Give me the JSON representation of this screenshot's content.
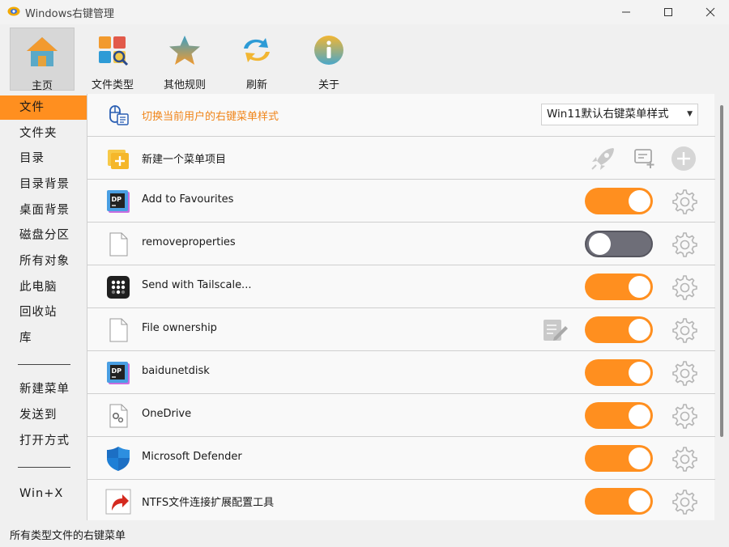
{
  "window": {
    "title": "Windows右键管理"
  },
  "toolbar": {
    "items": [
      {
        "label": "主页",
        "icon": "home-icon",
        "active": true
      },
      {
        "label": "文件类型",
        "icon": "file-types-icon"
      },
      {
        "label": "其他规则",
        "icon": "star-icon"
      },
      {
        "label": "刷新",
        "icon": "refresh-icon"
      },
      {
        "label": "关于",
        "icon": "info-icon"
      }
    ]
  },
  "sidebar": {
    "items": [
      {
        "label": "文件",
        "selected": true
      },
      {
        "label": "文件夹"
      },
      {
        "label": "目录"
      },
      {
        "label": "目录背景"
      },
      {
        "label": "桌面背景"
      },
      {
        "label": "磁盘分区"
      },
      {
        "label": "所有对象"
      },
      {
        "label": "此电脑"
      },
      {
        "label": "回收站"
      },
      {
        "label": "库"
      },
      {
        "label": "新建菜单"
      },
      {
        "label": "发送到"
      },
      {
        "label": "打开方式"
      },
      {
        "label": "Win+X"
      }
    ]
  },
  "content": {
    "switch_style": {
      "label": "切换当前用户的右键菜单样式",
      "dropdown_value": "Win11默认右键菜单样式",
      "icon": "mouse-menu-icon"
    },
    "new_item": {
      "label": "新建一个菜单项目",
      "icon": "new-folder-item-icon"
    },
    "rows": [
      {
        "label": "Add to Favourites",
        "icon": "dp-app-icon",
        "enabled": true
      },
      {
        "label": "removeproperties",
        "icon": "blank-file-icon",
        "enabled": false
      },
      {
        "label": "Send with Tailscale...",
        "icon": "tailscale-icon",
        "enabled": true
      },
      {
        "label": "File ownership",
        "icon": "blank-file-icon",
        "enabled": true,
        "editable": true
      },
      {
        "label": "baidunetdisk",
        "icon": "dp-app-icon",
        "enabled": true
      },
      {
        "label": "OneDrive",
        "icon": "settings-file-icon",
        "enabled": true
      },
      {
        "label": "Microsoft Defender",
        "icon": "defender-shield-icon",
        "enabled": true
      },
      {
        "label": "NTFS文件连接扩展配置工具",
        "icon": "shortcut-arrow-icon",
        "enabled": true
      }
    ]
  },
  "status": {
    "text": "所有类型文件的右键菜单"
  },
  "colors": {
    "accent": "#ff8f1f",
    "toggle_off": "#6e6e78",
    "label_orange": "#f08418"
  }
}
